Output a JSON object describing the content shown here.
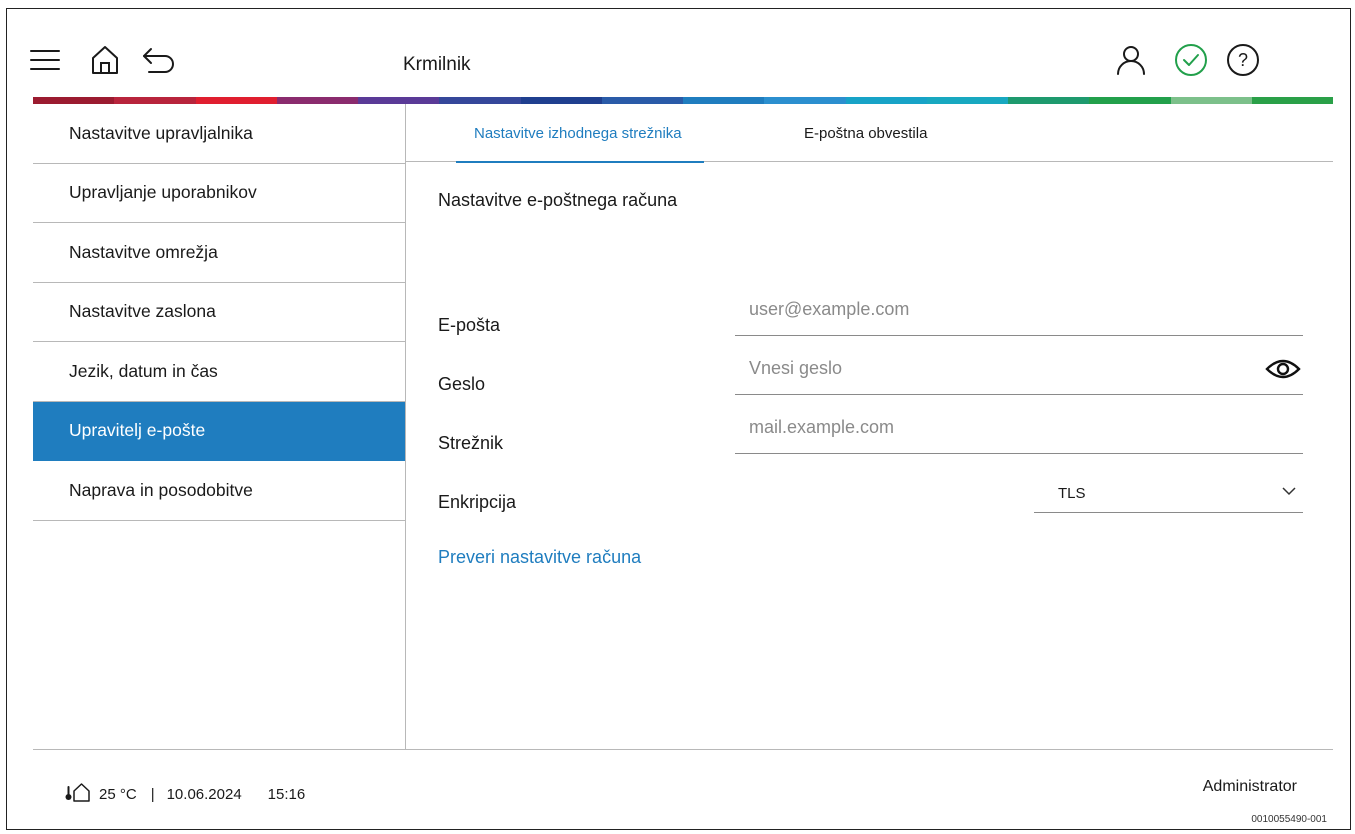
{
  "header": {
    "title": "Krmilnik",
    "icons": [
      "menu-icon",
      "home-icon",
      "back-icon",
      "user-icon",
      "check-circle-icon",
      "help-icon"
    ],
    "accent_color": "#1f7dbf",
    "ok_color": "#22a04b"
  },
  "rainbow": [
    "#9b1b30",
    "#b8243c",
    "#e01e2f",
    "#8a2b6e",
    "#5a3a97",
    "#35479a",
    "#1f3f8f",
    "#2a5ba8",
    "#1f7dbf",
    "#2b8fcf",
    "#17a3c7",
    "#18a8c0",
    "#1e9a6e",
    "#22a04b",
    "#7cc08a",
    "#2aa048"
  ],
  "sidebar": {
    "items": [
      {
        "label": "Nastavitve upravljalnika"
      },
      {
        "label": "Upravljanje uporabnikov"
      },
      {
        "label": "Nastavitve omrežja"
      },
      {
        "label": "Nastavitve zaslona"
      },
      {
        "label": "Jezik, datum in čas"
      },
      {
        "label": "Upravitelj e-pošte"
      },
      {
        "label": "Naprava in posodobitve"
      }
    ],
    "active_index": 5
  },
  "tabs": [
    {
      "label": "Nastavitve izhodnega strežnika"
    },
    {
      "label": "E-poštna obvestila"
    }
  ],
  "form": {
    "section_title": "Nastavitve e-poštnega računa",
    "email": {
      "label": "E-pošta",
      "placeholder": "user@example.com",
      "value": ""
    },
    "password": {
      "label": "Geslo",
      "placeholder": "Vnesi geslo",
      "value": ""
    },
    "server": {
      "label": "Strežnik",
      "placeholder": "mail.example.com",
      "value": ""
    },
    "encryption": {
      "label": "Enkripcija",
      "value": "TLS"
    },
    "verify_link": "Preveri nastavitve računa"
  },
  "footer": {
    "temperature": "25 °C",
    "separator": "|",
    "date": "10.06.2024",
    "time": "15:16",
    "user": "Administrator"
  },
  "reference": "0010055490-001"
}
